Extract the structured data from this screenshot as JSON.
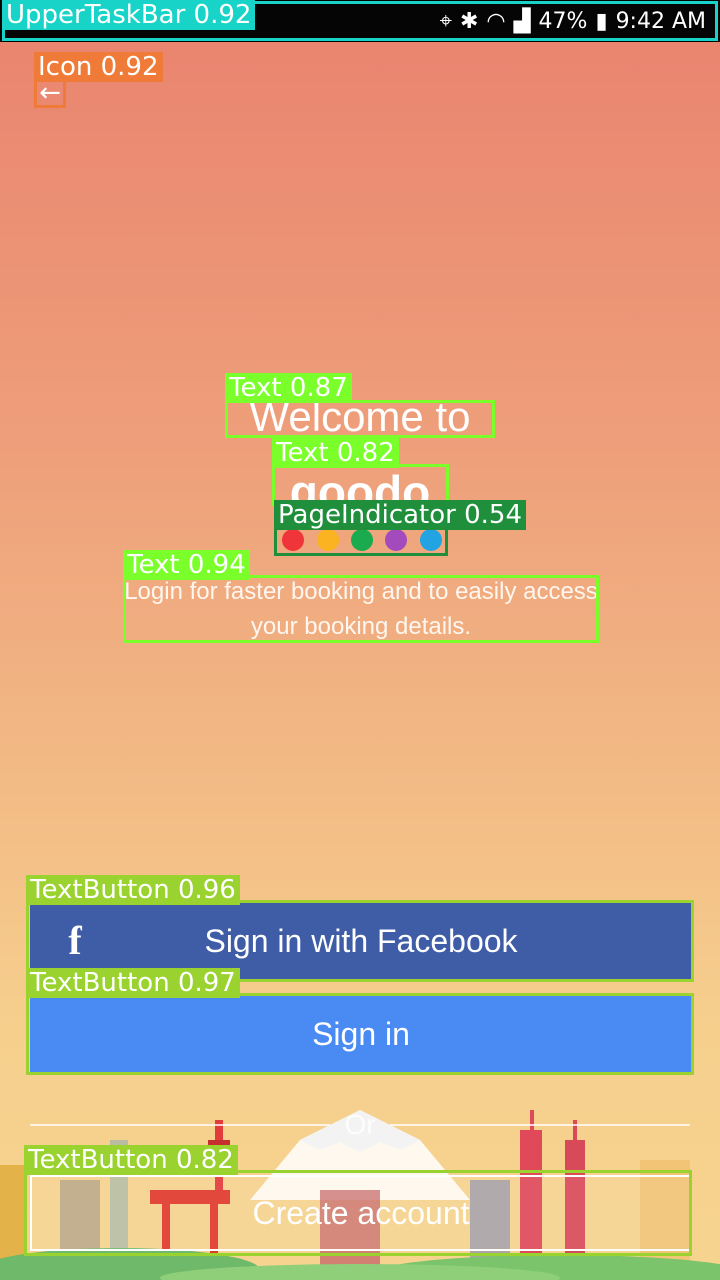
{
  "status_bar": {
    "battery": "47%",
    "time": "9:42 AM"
  },
  "header": {
    "back_icon": "arrow-left-icon"
  },
  "main": {
    "welcome": "Welcome to",
    "brand": "goodo",
    "subtitle": "Login for faster booking and to easily access your booking details.",
    "page_indicator": {
      "dots": [
        "#f0353a",
        "#fbb321",
        "#1aab4f",
        "#a34bbd",
        "#22a3e2"
      ]
    }
  },
  "actions": {
    "facebook_label": "Sign in with Facebook",
    "facebook_icon": "facebook-icon",
    "signin_label": "Sign in",
    "or_label": "Or",
    "create_label": "Create account"
  },
  "detections": [
    {
      "label": "UpperTaskBar 0.92"
    },
    {
      "label": "Icon 0.92"
    },
    {
      "label": "Text 0.87"
    },
    {
      "label": "Text 0.82"
    },
    {
      "label": "PageIndicator 0.54"
    },
    {
      "label": "Text 0.94"
    },
    {
      "label": "TextButton 0.96"
    },
    {
      "label": "TextButton 0.97"
    },
    {
      "label": "TextButton 0.82"
    }
  ],
  "colors": {
    "facebook_blue": "#3f5ca7",
    "signin_blue": "#4a8af3",
    "box_green": "#7bff2a"
  }
}
